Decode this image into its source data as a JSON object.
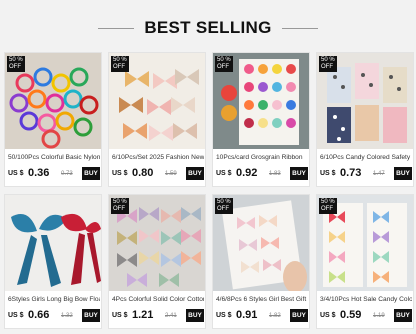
{
  "section": {
    "title": "BEST SELLING"
  },
  "colors": {
    "badge_bg": "#111111",
    "buy_bg": "#111111",
    "background": "#f2f2f2"
  },
  "products": [
    {
      "badge": "50 % OFF",
      "name": "50/100Pcs Colorful Basic Nylon",
      "currency": "US $",
      "price": "0.36",
      "old_price": "0.73",
      "buy_label": "BUY"
    },
    {
      "badge": "50 % OFF",
      "name": "6/10Pcs/Set 2025 Fashion New",
      "currency": "US $",
      "price": "0.80",
      "old_price": "1.59",
      "buy_label": "BUY"
    },
    {
      "badge": "50 % OFF",
      "name": "10Pcs/card Grosgrain Ribbon",
      "currency": "US $",
      "price": "0.92",
      "old_price": "1.83",
      "buy_label": "BUY"
    },
    {
      "badge": "50 % OFF",
      "name": "6/10Pcs Candy Colored Safety",
      "currency": "US $",
      "price": "0.73",
      "old_price": "1.47",
      "buy_label": "BUY"
    },
    {
      "badge": "",
      "name": "6Styles Girls Long Big Bow Float",
      "currency": "US $",
      "price": "0.66",
      "old_price": "1.32",
      "buy_label": "BUY"
    },
    {
      "badge": "50 % OFF",
      "name": "4Pcs Colorful Solid Color Cotton",
      "currency": "US $",
      "price": "1.21",
      "old_price": "2.41",
      "buy_label": "BUY"
    },
    {
      "badge": "50 % OFF",
      "name": "4/6/8Pcs 6 Styles Girl Best Gift",
      "currency": "US $",
      "price": "0.91",
      "old_price": "1.82",
      "buy_label": "BUY"
    },
    {
      "badge": "50 % OFF",
      "name": "3/4/10Pcs Hot Sale Candy Color",
      "currency": "US $",
      "price": "0.59",
      "old_price": "1.19",
      "buy_label": "BUY"
    }
  ]
}
